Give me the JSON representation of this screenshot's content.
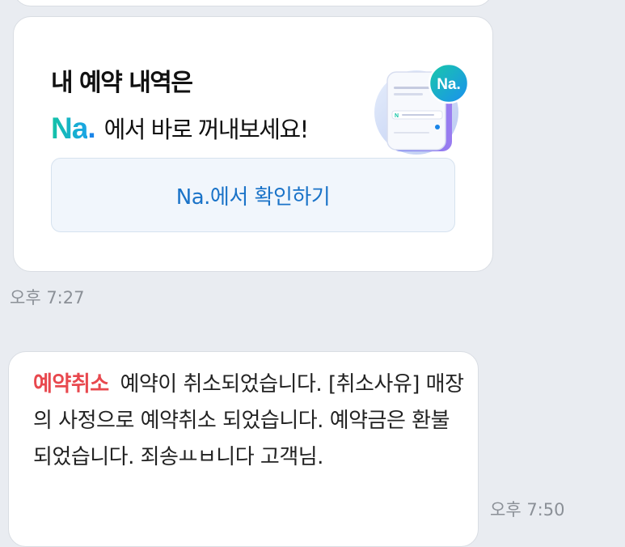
{
  "promo_card": {
    "title": "내 예약 내역은",
    "logo_text": "Na",
    "logo_dot": ".",
    "subtitle": "에서 바로 꺼내보세요!",
    "badge_text": "Na.",
    "button_label": "Na.에서 확인하기"
  },
  "time_1": "오후 7:27",
  "cancel_message": {
    "tag": "예약취소",
    "text": "예약이 취소되었습니다. [취소사유] 매장의 사정으로 예약취소 되었습니다. 예약금은 환불 되었습니다. 죄송ㅛㅂ니다 고객님."
  },
  "time_2": "오후 7:50",
  "colors": {
    "background": "#e9ecf1",
    "accent_red": "#e8484e",
    "accent_blue": "#1a73c8",
    "na_green": "#12c3a6"
  }
}
